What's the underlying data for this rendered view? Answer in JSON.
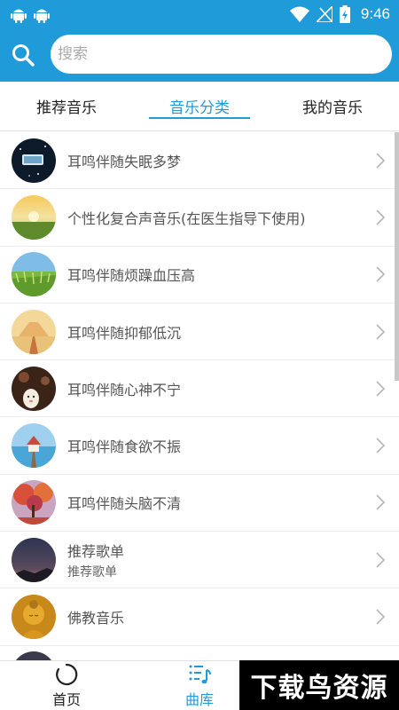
{
  "statusbar": {
    "time": "9:46",
    "icons": [
      "android-icon",
      "android-icon",
      "wifi-icon",
      "no-signal-icon",
      "battery-charging-icon"
    ]
  },
  "search": {
    "placeholder": "搜索",
    "value": ""
  },
  "tabs": [
    {
      "label": "推荐音乐",
      "active": false
    },
    {
      "label": "音乐分类",
      "active": true
    },
    {
      "label": "我的音乐",
      "active": false
    }
  ],
  "list": [
    {
      "title": "耳鸣伴随失眠多梦",
      "subtitle": "",
      "thumb": "night-sky-thumb"
    },
    {
      "title": "个性化复合声音乐(在医生指导下使用)",
      "subtitle": "",
      "thumb": "sunset-meadow-thumb"
    },
    {
      "title": "耳鸣伴随烦躁血压高",
      "subtitle": "",
      "thumb": "wheat-field-thumb"
    },
    {
      "title": "耳鸣伴随抑郁低沉",
      "subtitle": "",
      "thumb": "desert-road-thumb"
    },
    {
      "title": "耳鸣伴随心神不宁",
      "subtitle": "",
      "thumb": "cartoon-character-thumb"
    },
    {
      "title": "耳鸣伴随食欲不振",
      "subtitle": "",
      "thumb": "pier-house-thumb"
    },
    {
      "title": "耳鸣伴随头脑不清",
      "subtitle": "",
      "thumb": "autumn-trees-thumb"
    },
    {
      "title": "推荐歌单",
      "subtitle": "推荐歌单",
      "thumb": "dusk-sky-thumb"
    },
    {
      "title": "佛教音乐",
      "subtitle": "",
      "thumb": "buddha-thumb"
    }
  ],
  "bottomnav": [
    {
      "label": "首页",
      "icon": "loading-circle-icon",
      "active": false
    },
    {
      "label": "曲库",
      "icon": "music-list-icon",
      "active": true
    }
  ],
  "watermark": "下载鸟资源",
  "colors": {
    "primary": "#1f9bd9",
    "text": "#555555",
    "divider": "#eeeeee"
  }
}
